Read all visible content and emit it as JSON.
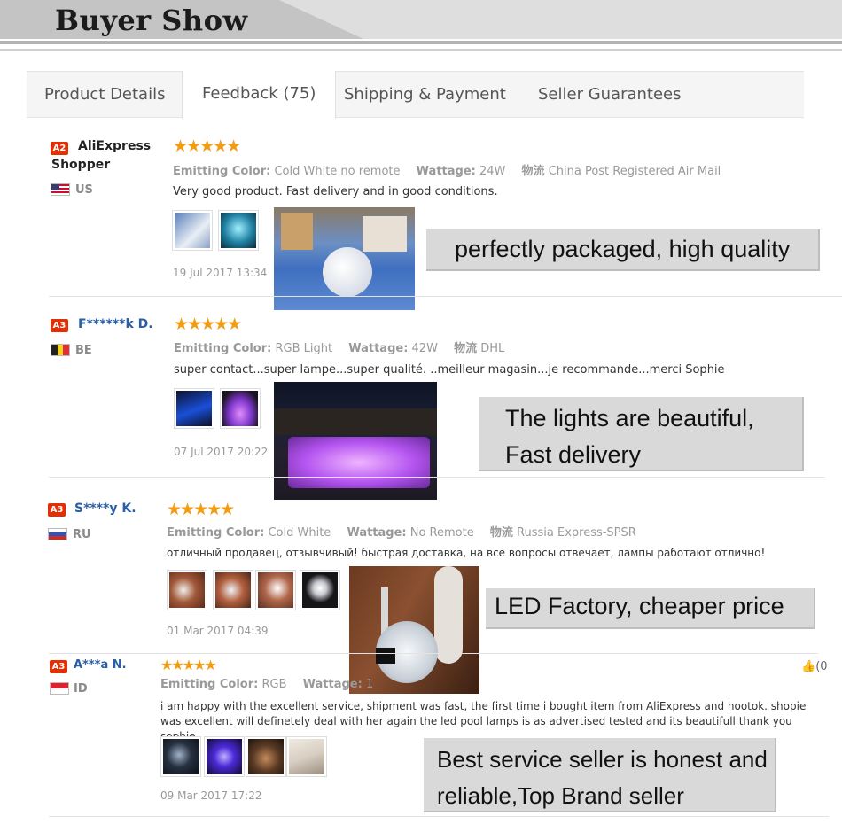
{
  "banner": {
    "title": "Buyer Show"
  },
  "tabs": [
    {
      "label": "Product Details",
      "active": false
    },
    {
      "label": "Feedback (75)",
      "active": true
    },
    {
      "label": "Shipping & Payment",
      "active": false
    },
    {
      "label": "Seller Guarantees",
      "active": false
    }
  ],
  "labels": {
    "emitting_color": "Emitting Color:",
    "wattage": "Wattage:",
    "logistics": "物流"
  },
  "reviews": [
    {
      "level": "A2",
      "name": "AliExpress Shopper",
      "country": "US",
      "stars": "★★★★★",
      "emitting_color": "Cold White no remote",
      "wattage": "24W",
      "logistics": "China Post Registered Air Mail",
      "comment": "Very good product. Fast delivery and in good conditions.",
      "date": "19 Jul 2017 13:34",
      "callout": [
        "perfectly packaged, high quality"
      ]
    },
    {
      "level": "A3",
      "name": "F******k D.",
      "country": "BE",
      "stars": "★★★★★",
      "emitting_color": "RGB Light",
      "wattage": "42W",
      "logistics": "DHL",
      "comment": "super contact...super lampe...super qualité. ..meilleur magasin...je recommande...merci Sophie",
      "date": "07 Jul 2017 20:22",
      "callout": [
        "The lights are beautiful,",
        "Fast delivery"
      ]
    },
    {
      "level": "A3",
      "name": "S****y K.",
      "country": "RU",
      "stars": "★★★★★",
      "emitting_color": "Cold White",
      "wattage": "No Remote",
      "logistics": "Russia Express-SPSR",
      "comment": "отличный продавец, отзывчивый! быстрая доставка, на все вопросы отвечает, лампы работают отлично!",
      "date": "01 Mar 2017 04:39",
      "callout": [
        "LED Factory, cheaper price"
      ]
    },
    {
      "level": "A3",
      "name": "A***a N.",
      "country": "ID",
      "stars": "★★★★★",
      "emitting_color": "RGB",
      "wattage": "1",
      "comment": "i am happy with the excellent service, shipment was fast, the first time i bought item from AliExpress and hootok. shopie was excellent will definetely deal with her again the led pool lamps is as advertised tested and its beautifull thank you sophie",
      "date": "09 Mar 2017 17:22",
      "callout": [
        "Best service seller is honest and",
        "reliable,Top Brand seller"
      ],
      "helpful": "(0"
    }
  ],
  "colors": {
    "accent_star": "#f39c12",
    "badge": "#e62e04",
    "name_link": "#2a5fa8"
  }
}
